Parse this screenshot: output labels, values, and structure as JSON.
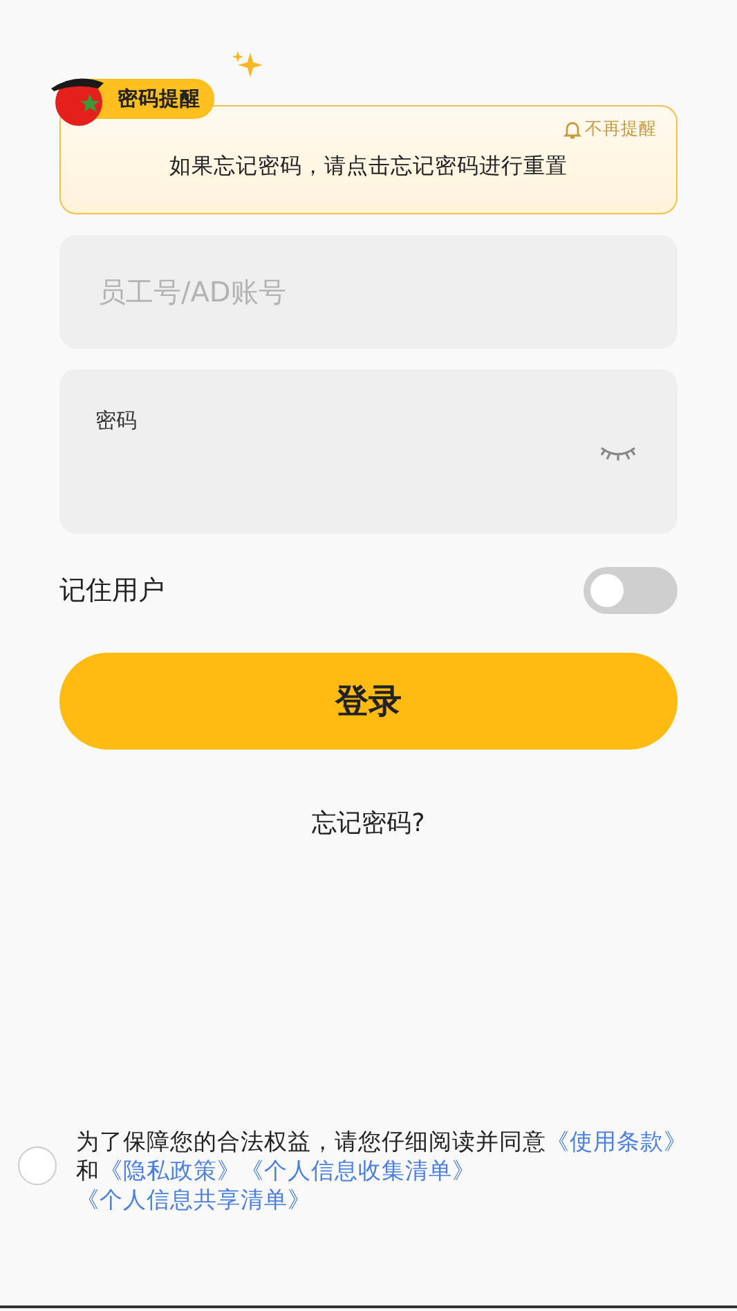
{
  "reminder": {
    "badge": "密码提醒",
    "dismiss": "不再提醒",
    "message": "如果忘记密码，请点击忘记密码进行重置"
  },
  "username": {
    "placeholder": "员工号/AD账号"
  },
  "password": {
    "label": "密码",
    "visible": false
  },
  "remember": {
    "label": "记住用户",
    "on": false
  },
  "login_button": "登录",
  "forgot_link": "忘记密码?",
  "consent": {
    "checked": false,
    "segments": [
      {
        "kind": "text",
        "text": "为了保障您的合法权益，请您仔细阅读并同意"
      },
      {
        "kind": "link",
        "text": "《使用条款》"
      },
      {
        "kind": "text",
        "text": "和"
      },
      {
        "kind": "link",
        "text": "《隐私政策》"
      },
      {
        "kind": "link",
        "text": "《个人信息收集清单》"
      },
      {
        "kind": "link",
        "text": "《个人信息共享清单》"
      }
    ]
  }
}
